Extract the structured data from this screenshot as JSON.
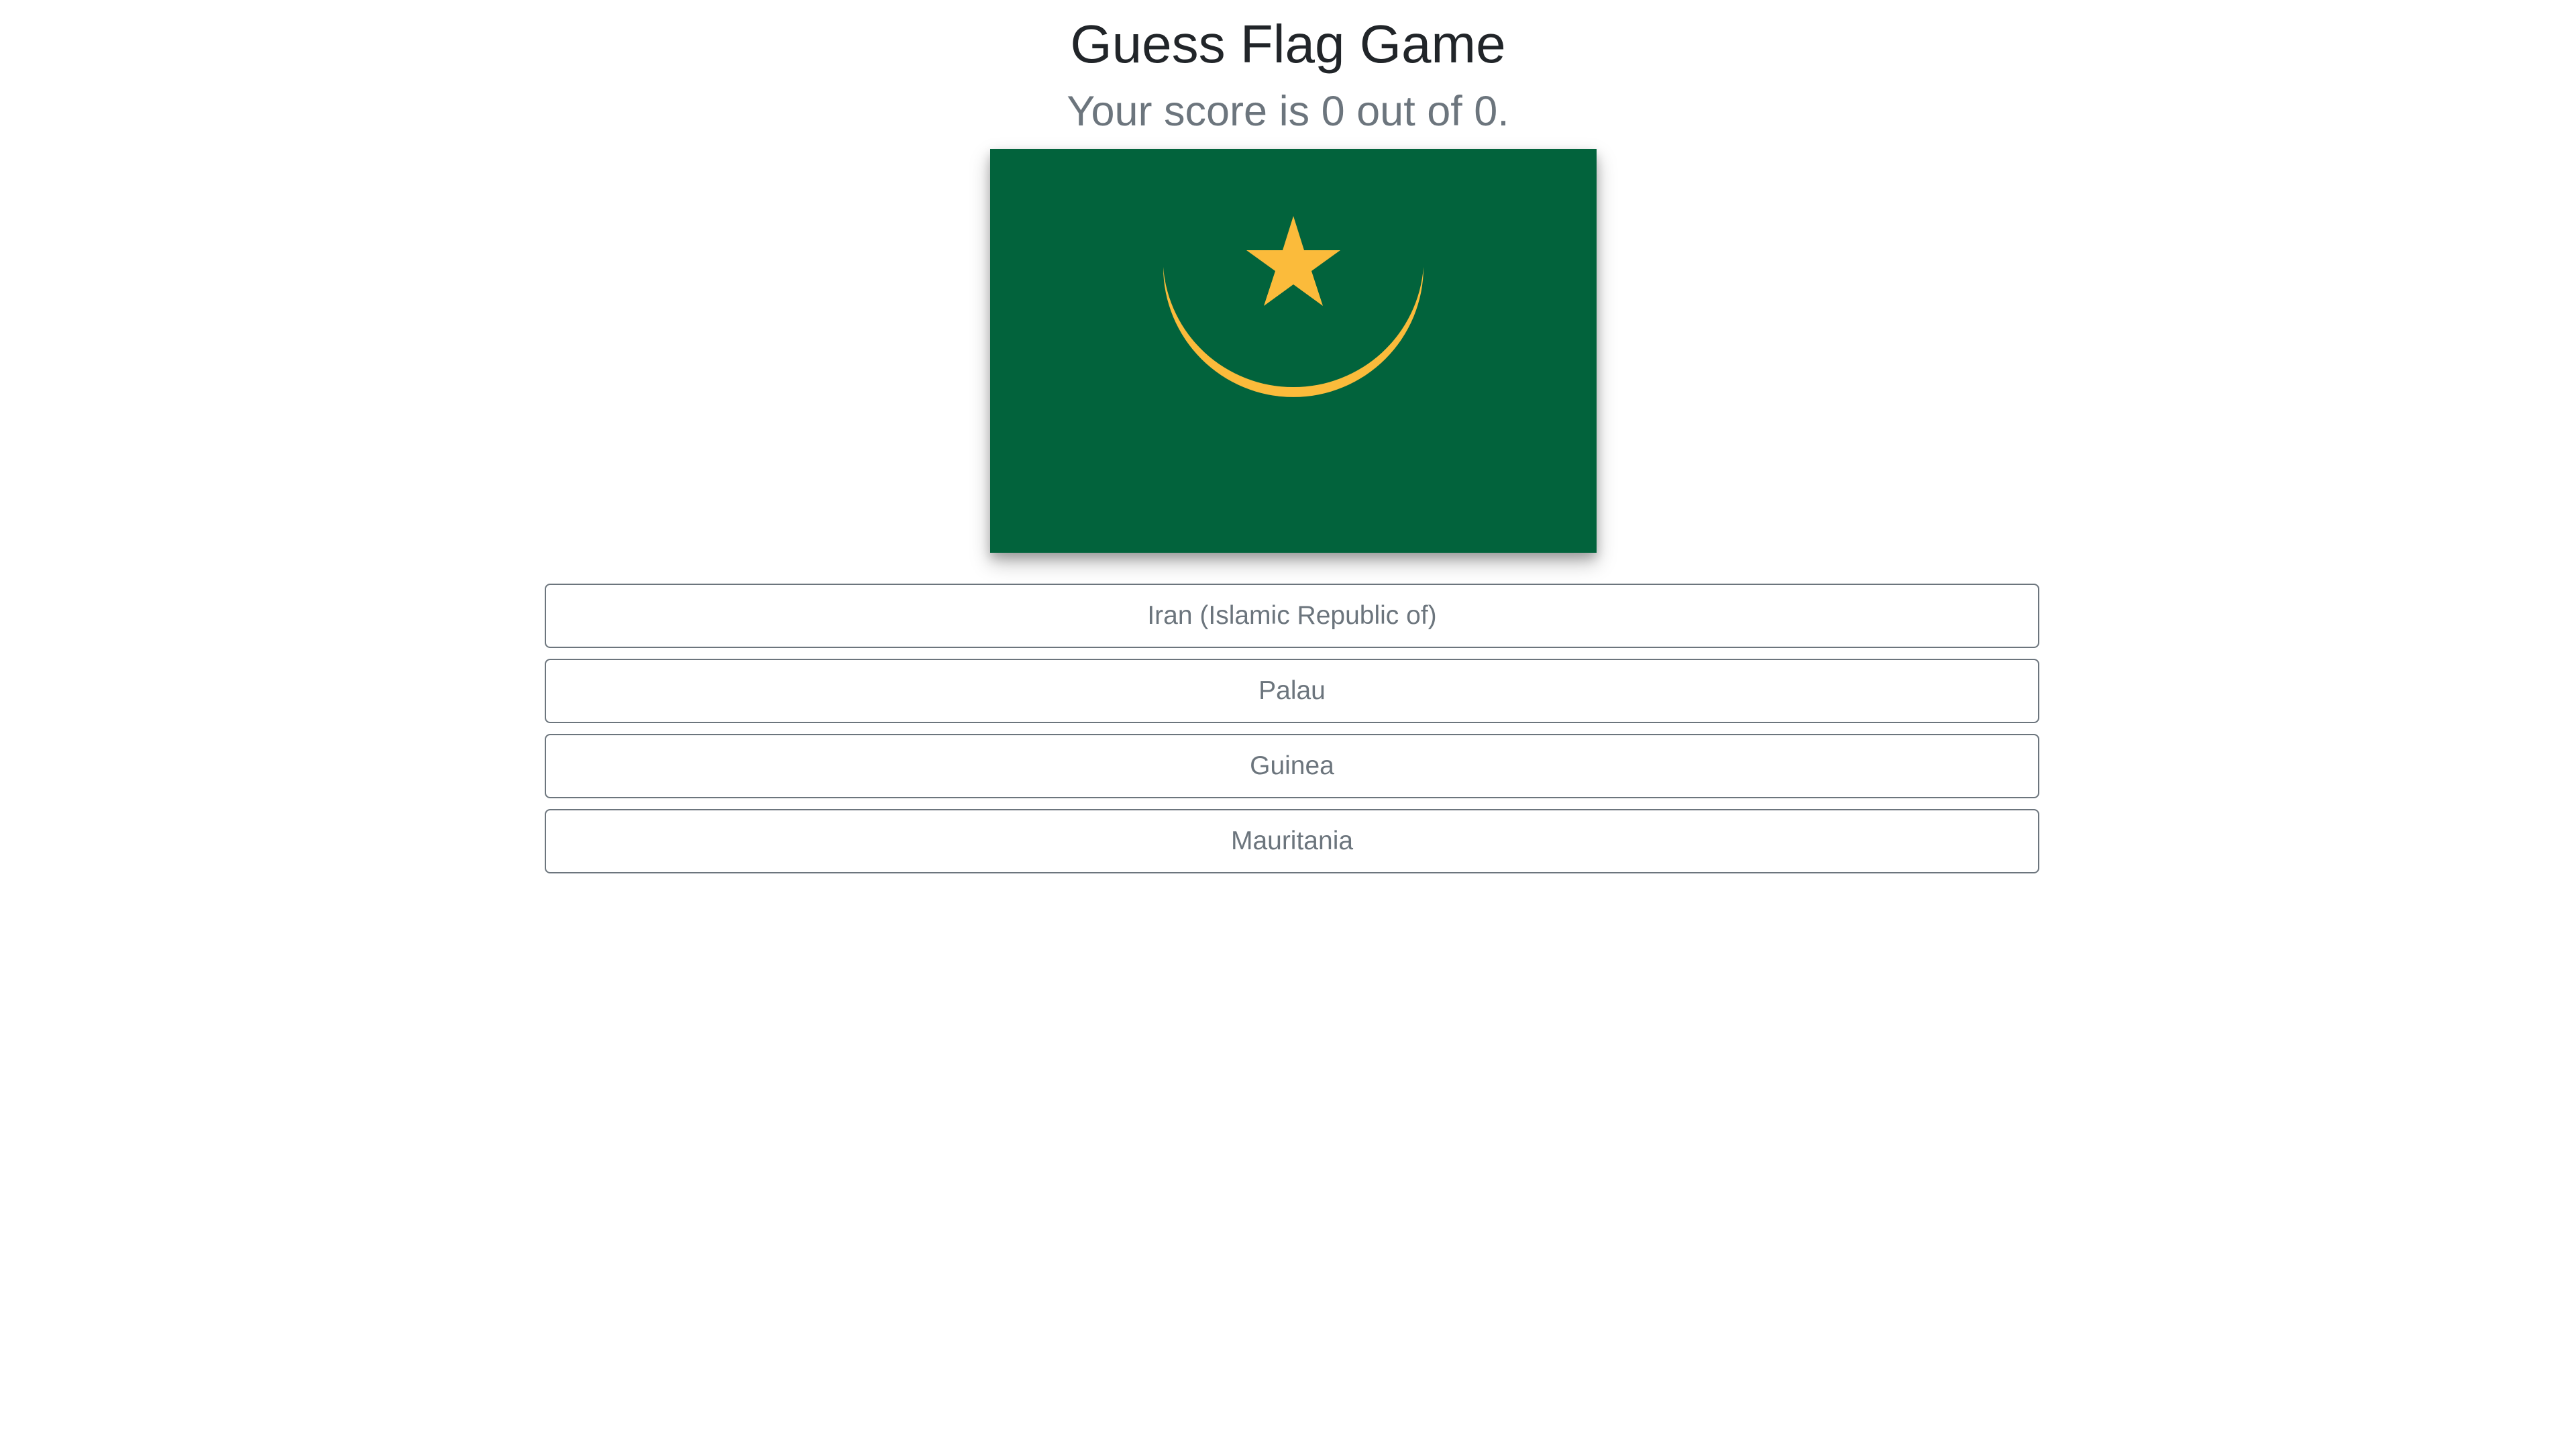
{
  "header": {
    "title": "Guess Flag Game",
    "score_text": "Your score is 0 out of 0."
  },
  "flag": {
    "icon": "mauritania-flag-icon",
    "colors": {
      "field": "#02633c",
      "emblem": "#fbbb3b"
    }
  },
  "answers": [
    {
      "label": "Iran (Islamic Republic of)"
    },
    {
      "label": "Palau"
    },
    {
      "label": "Guinea"
    },
    {
      "label": "Mauritania"
    }
  ],
  "theme": {
    "title_color": "#212529",
    "muted_color": "#6c757d",
    "background": "#ffffff"
  }
}
